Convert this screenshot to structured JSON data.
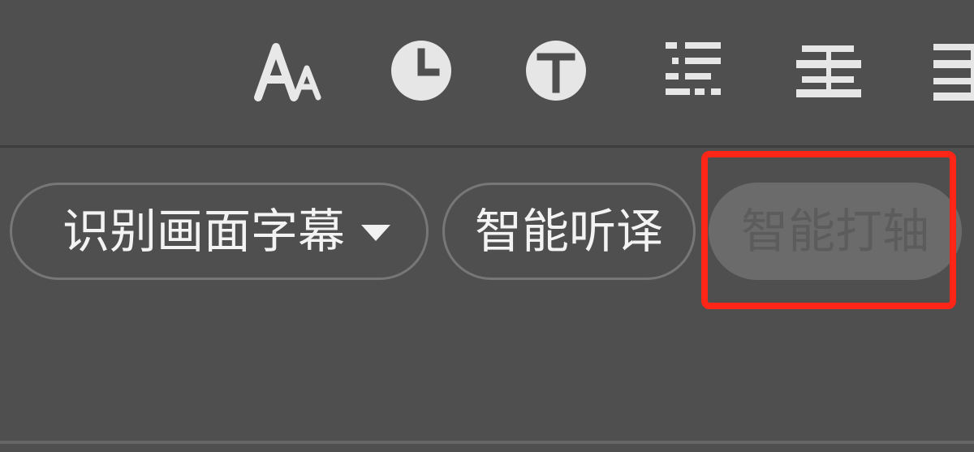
{
  "toolbar": {
    "icons": [
      "font-size-icon",
      "clock-icon",
      "text-circle-icon",
      "sliders-icon",
      "align-center-icon",
      "align-right-icon"
    ]
  },
  "actions": {
    "recognize_label": "识别画面字幕",
    "listen_label": "智能听译",
    "timeline_label": "智能打轴"
  },
  "colors": {
    "background": "#4f4f4f",
    "button_border": "#777777",
    "button_text": "#f3f3f3",
    "disabled_fill": "#6b6b6b",
    "disabled_text": "#5c5c5c",
    "highlight": "#ff2617"
  }
}
